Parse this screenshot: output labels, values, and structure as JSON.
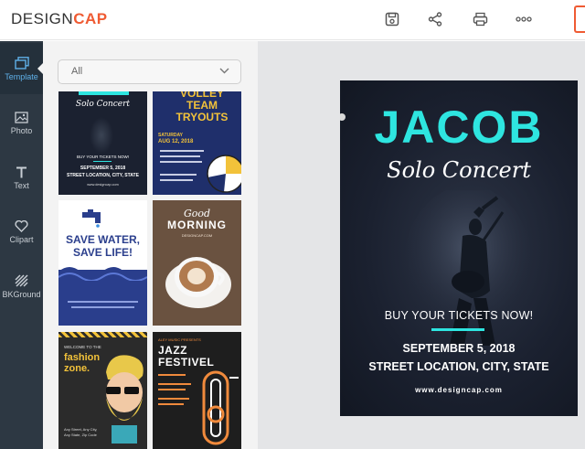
{
  "app": {
    "logo_part1": "DESIGN",
    "logo_part2": "CAP",
    "accent_color": "#ef5b33"
  },
  "toolbar": {
    "icons": [
      "save-icon",
      "share-icon",
      "print-icon",
      "more-icon"
    ]
  },
  "sidebar": {
    "items": [
      {
        "label": "Template",
        "icon": "template-icon",
        "active": true
      },
      {
        "label": "Photo",
        "icon": "photo-icon",
        "active": false
      },
      {
        "label": "Text",
        "icon": "text-icon",
        "active": false
      },
      {
        "label": "Clipart",
        "icon": "heart-icon",
        "active": false
      },
      {
        "label": "BKGround",
        "icon": "background-icon",
        "active": false
      }
    ]
  },
  "panel": {
    "filter_value": "All",
    "templates": [
      {
        "title": "Solo Concert",
        "lines": [
          "BUY YOUR TICKETS NOW!",
          "SEPTEMBER 5, 2018",
          "STREET LOCATION, CITY, STATE",
          "www.designcap.com"
        ]
      },
      {
        "title": "VOLLEY TEAM TRYOUTS",
        "lines": [
          "SATURDAY",
          "AUG 12, 2018"
        ]
      },
      {
        "title": "SAVE WATER, SAVE LIFE!",
        "lines": []
      },
      {
        "title_script": "Good",
        "title": "MORNING",
        "lines": [
          "DESIGNCAP.COM"
        ]
      },
      {
        "title_small": "WELCOME TO THE",
        "title": "fashion zone.",
        "lines": [
          "Any Street, Any City,",
          "Any State, Zip Code"
        ]
      },
      {
        "title_small": "ALEY MUSIC PRESENTS",
        "title": "JAZZ FESTIVEL",
        "lines": []
      }
    ]
  },
  "poster": {
    "title": "JACOB",
    "subtitle": "Solo Concert",
    "buy": "BUY YOUR TICKETS NOW!",
    "date": "SEPTEMBER 5, 2018",
    "location": "STREET LOCATION, CITY, STATE",
    "website": "www.designcap.com",
    "accent": "#2ee5e0"
  }
}
